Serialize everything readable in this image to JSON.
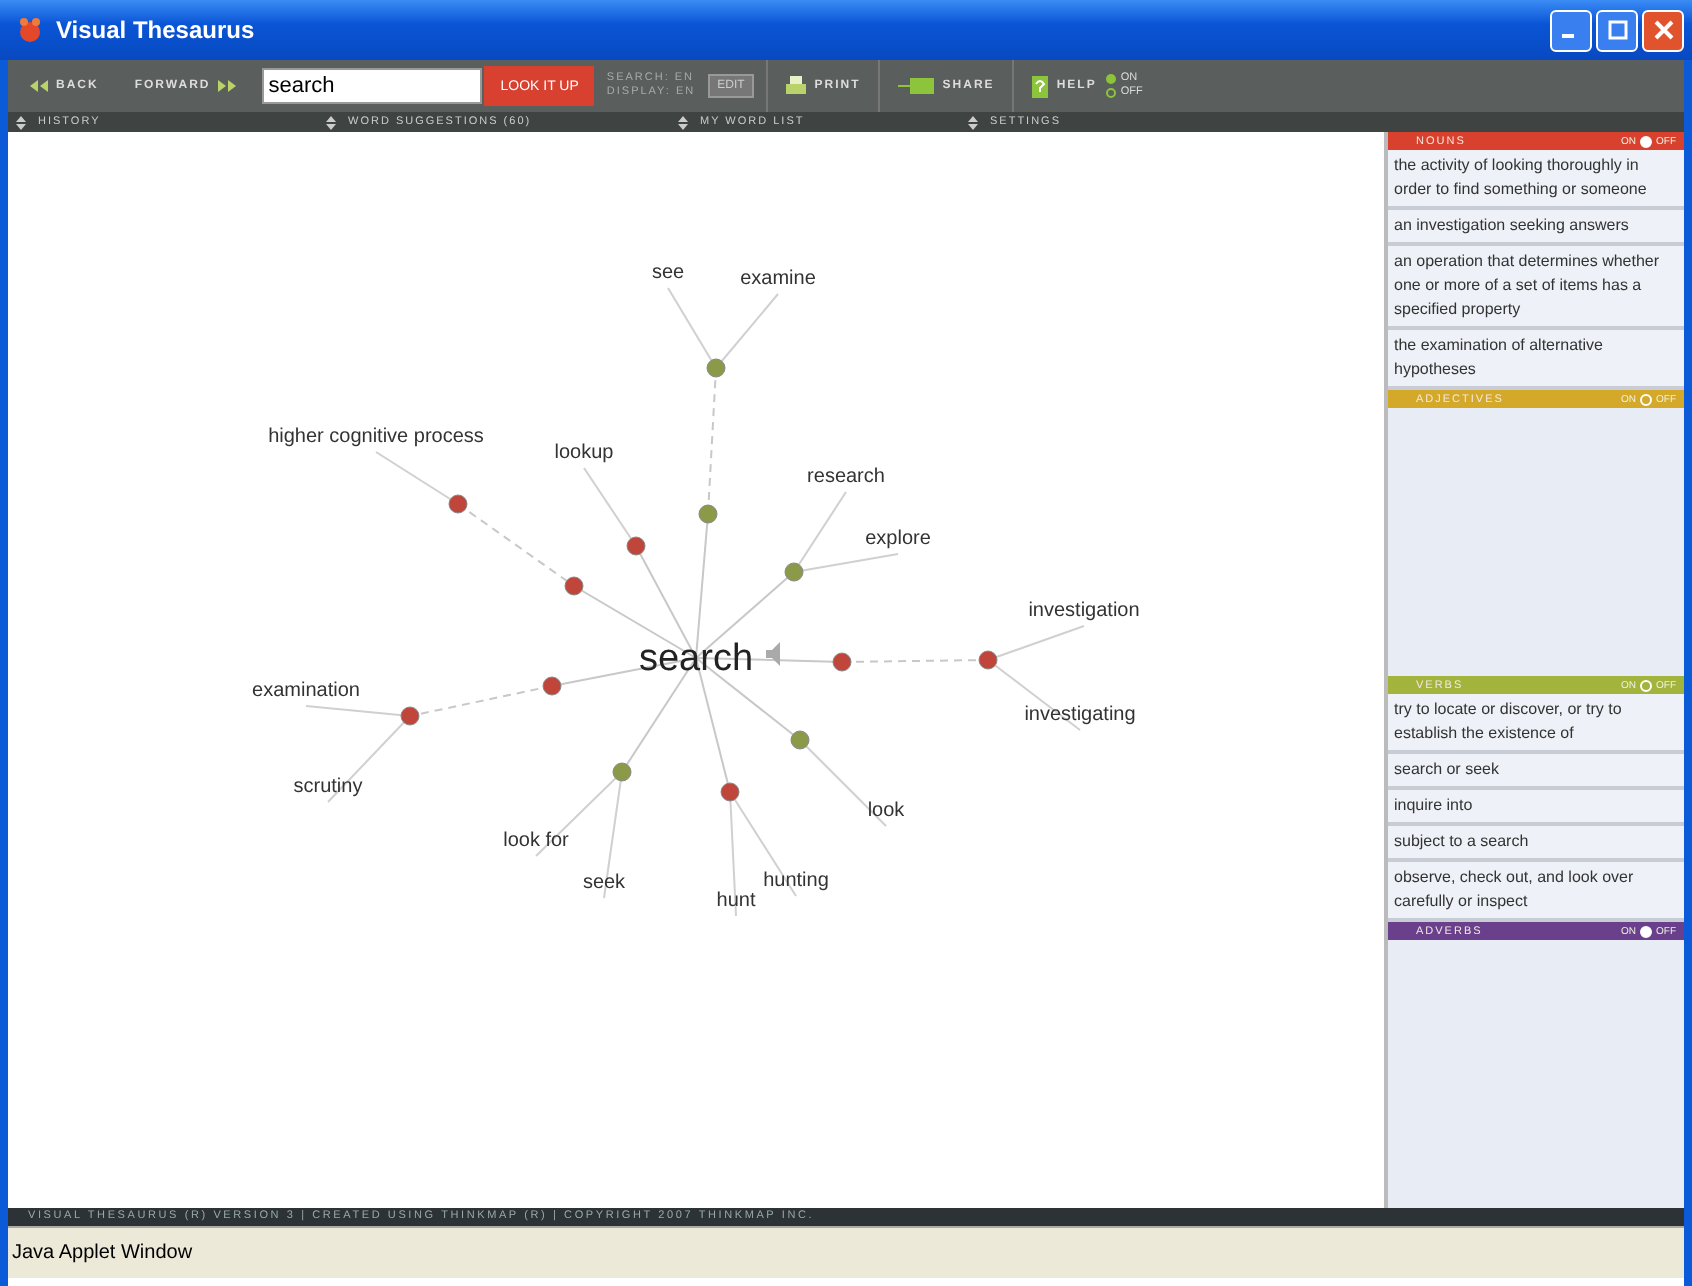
{
  "window": {
    "title": "Visual Thesaurus"
  },
  "toolbar": {
    "back": "BACK",
    "forward": "FORWARD",
    "search_value": "search",
    "lookup": "LOOK IT UP",
    "search_lang": "SEARCH: EN",
    "display_lang": "DISPLAY: EN",
    "edit": "EDIT",
    "print": "PRINT",
    "share": "SHARE",
    "help": "HELP",
    "help_on_label": "ON",
    "help_off_label": "OFF",
    "help_on": true
  },
  "subbar": [
    "HISTORY",
    "WORD SUGGESTIONS (60)",
    "MY WORD LIST",
    "SETTINGS"
  ],
  "graph": {
    "center": "search",
    "nodes": [
      {
        "color": "#c0453a"
      },
      {
        "color": "#c0453a"
      },
      {
        "color": "#c0453a"
      },
      {
        "color": "#8a9a48"
      },
      {
        "color": "#8a9a48"
      },
      {
        "color": "#8a9a48"
      },
      {
        "color": "#c0453a"
      },
      {
        "color": "#c0453a"
      },
      {
        "color": "#c0453a"
      },
      {
        "color": "#c0453a"
      },
      {
        "color": "#8a9a48"
      },
      {
        "color": "#c0453a"
      },
      {
        "color": "#8a9a48"
      }
    ],
    "words": [
      "see",
      "examine",
      "higher cognitive process",
      "lookup",
      "research",
      "explore",
      "investigation",
      "investigating",
      "examination",
      "scrutiny",
      "look for",
      "seek",
      "hunt",
      "hunting",
      "look"
    ]
  },
  "sections": [
    {
      "name": "NOUNS",
      "color": "#d9412f",
      "on_label": "ON",
      "off_label": "OFF",
      "on": true,
      "definitions": [
        "the activity of looking thoroughly in order to find something or someone",
        "an investigation seeking answers",
        "an operation that determines whether one or more of a set of items has a specified property",
        "the examination of alternative hypotheses"
      ]
    },
    {
      "name": "ADJECTIVES",
      "color": "#d4a92a",
      "on_label": "ON",
      "off_label": "OFF",
      "on": false
    },
    {
      "name": "VERBS",
      "color": "#a3b43c",
      "on_label": "ON",
      "off_label": "OFF",
      "on": false,
      "definitions": [
        "try to locate or discover, or try to establish the existence of",
        "search or seek",
        "inquire into",
        "subject to a search",
        "observe, check out, and look over carefully or inspect"
      ]
    },
    {
      "name": "ADVERBS",
      "color": "#6a3f8c",
      "on_label": "ON",
      "off_label": "OFF",
      "on": true
    }
  ],
  "footer": "VISUAL THESAURUS (R) VERSION 3 | CREATED USING THINKMAP (R) | COPYRIGHT 2007 THINKMAP INC.",
  "status_bar": "Java Applet Window"
}
